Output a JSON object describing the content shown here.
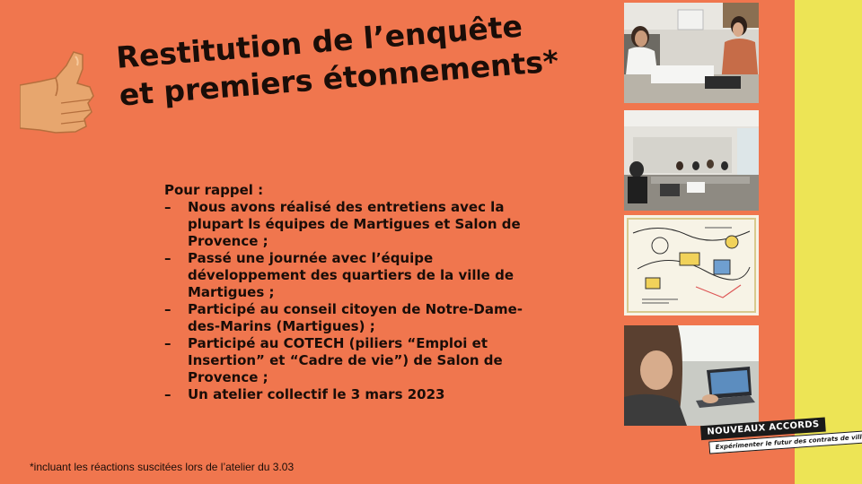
{
  "slide": {
    "title_lines": [
      "Restitution de l’enquête",
      "et premiers étonnements*"
    ],
    "lead": "Pour rappel :",
    "bullets": [
      "Nous avons réalisé des entretiens avec la plupart ls équipes de Martigues et Salon de Provence ;",
      "Passé une journée avec l’équipe développement des quartiers de la ville de Martigues ;",
      "Participé au conseil citoyen de Notre-Dame-des-Marins (Martigues) ;",
      "Participé au COTECH (piliers “Emploi et Insertion” et “Cadre de vie”) de Salon de Provence ;",
      "Un atelier collectif le 3 mars 2023"
    ],
    "bullet_marker": "–",
    "footnote": "*incluant les réactions suscitées lors de l’atelier du 3.03"
  },
  "logo": {
    "name": "NOUVEAUX ACCORDS",
    "tagline": "Expérimenter le futur des contrats de ville"
  },
  "colors": {
    "background": "#F0764E",
    "band": "#EDE455",
    "text": "#1A0D08"
  },
  "icons": [
    "thumbs-up-icon"
  ]
}
